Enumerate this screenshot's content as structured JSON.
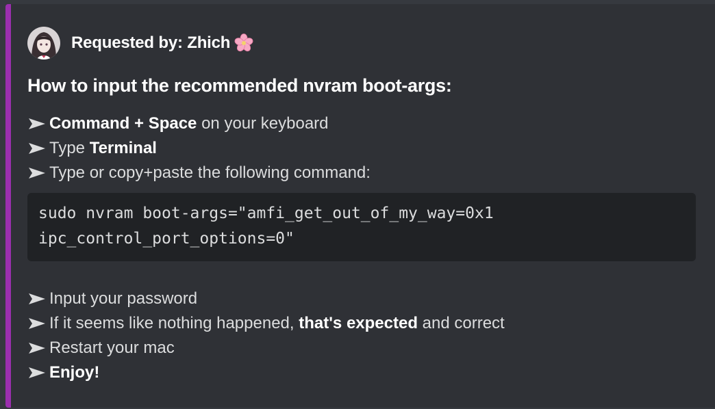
{
  "embed": {
    "accent_color": "#9b2fae",
    "author": {
      "text": "Requested by: Zhich",
      "emoji_icon": "cherry-blossom-icon",
      "avatar_icon": "anime-avatar-icon"
    },
    "title": "How to input the recommended nvram boot-args:",
    "steps_before": [
      {
        "bold": "Command + Space",
        "rest": " on your keyboard"
      },
      {
        "pre": "Type ",
        "bold": "Terminal"
      },
      {
        "pre": "Type or copy+paste the following command:"
      }
    ],
    "code": {
      "line1": "sudo nvram boot-args=\"amfi_get_out_of_my_way=0x1",
      "line2": "ipc_control_port_options=0\""
    },
    "steps_after": [
      {
        "pre": "Input your password"
      },
      {
        "pre": "If it seems like nothing happened, ",
        "bold": "that's expected",
        "rest": " and correct"
      },
      {
        "pre": "Restart your mac"
      },
      {
        "bold": "Enjoy!"
      }
    ]
  }
}
